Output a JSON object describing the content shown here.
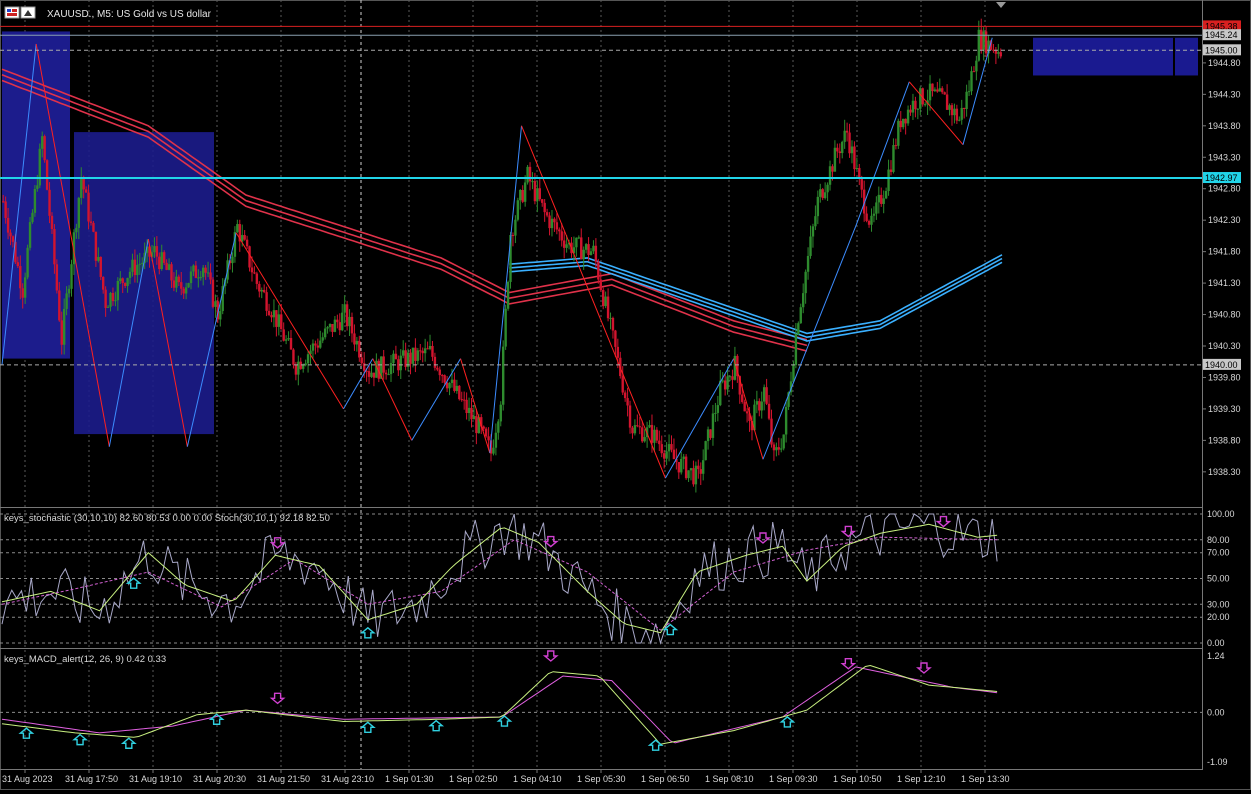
{
  "window": {
    "title": "XAUUSD., M5:  US Gold vs US dollar",
    "menu_icon": "chart-window-menu-icon"
  },
  "price_panel": {
    "price_labels": [
      "1944.80",
      "1944.30",
      "1943.80",
      "1943.30",
      "1942.80",
      "1942.30",
      "1941.80",
      "1941.30",
      "1940.80",
      "1940.30",
      "1939.80",
      "1939.30",
      "1938.80",
      "1938.30"
    ],
    "ask_label": "1945.38",
    "bid_label": "1945.24",
    "level_label_1945": "1945.00",
    "level_label_1940": "1940.00",
    "hline_label": "1942.97",
    "colors": {
      "bull": "#2e8b2e",
      "bear": "#d2142e",
      "zigzag_up": "#3c8cff",
      "zigzag_down": "#ff2020",
      "ma_red": "#e0324a",
      "ma_blue": "#3ab0ff",
      "hline": "#21d4e8",
      "box": "#1c1c8c"
    }
  },
  "stoch_panel": {
    "label": "keys_stochastic (30,10,10) 82.60 80.53 0.00 0.00 Stoch(30,10,1) 92.18 82.50",
    "scale": [
      "100.00",
      "80.00",
      "70.00",
      "50.00",
      "30.00",
      "20.00",
      "0.00"
    ]
  },
  "macd_panel": {
    "label": "keys_MACD_alert(12, 26, 9) 0.42 0.33",
    "scale": [
      "1.24",
      "0.00",
      "-1.09"
    ]
  },
  "time_axis": [
    "31 Aug 2023",
    "31 Aug 17:50",
    "31 Aug 19:10",
    "31 Aug 20:30",
    "31 Aug 21:50",
    "31 Aug 23:10",
    "1 Sep 01:30",
    "1 Sep 02:50",
    "1 Sep 04:10",
    "1 Sep 05:30",
    "1 Sep 06:50",
    "1 Sep 08:10",
    "1 Sep 09:30",
    "1 Sep 10:50",
    "1 Sep 12:10",
    "1 Sep 13:30"
  ],
  "chart_data": {
    "type": "candlestick",
    "title": "XAUUSD., M5:  US Gold vs US dollar",
    "y_range": [
      1937.9,
      1945.45
    ],
    "anchors": [
      [
        0,
        1942.6
      ],
      [
        8,
        1941.2
      ],
      [
        16,
        1943.6
      ],
      [
        24,
        1940.4
      ],
      [
        32,
        1943.0
      ],
      [
        42,
        1941.0
      ],
      [
        52,
        1941.5
      ],
      [
        62,
        1941.8
      ],
      [
        72,
        1941.2
      ],
      [
        82,
        1941.6
      ],
      [
        88,
        1940.8
      ],
      [
        96,
        1942.2
      ],
      [
        104,
        1941.3
      ],
      [
        110,
        1940.9
      ],
      [
        120,
        1940.0
      ],
      [
        140,
        1940.8
      ],
      [
        150,
        1939.9
      ],
      [
        175,
        1940.2
      ],
      [
        188,
        1939.4
      ],
      [
        195,
        1939.0
      ],
      [
        200,
        1938.6
      ],
      [
        204,
        1939.5
      ],
      [
        208,
        1942.1
      ],
      [
        215,
        1943.0
      ],
      [
        222,
        1942.4
      ],
      [
        232,
        1941.9
      ],
      [
        242,
        1941.8
      ],
      [
        250,
        1940.4
      ],
      [
        258,
        1939.0
      ],
      [
        266,
        1938.9
      ],
      [
        275,
        1938.5
      ],
      [
        285,
        1938.2
      ],
      [
        294,
        1939.6
      ],
      [
        300,
        1940.0
      ],
      [
        306,
        1939.0
      ],
      [
        312,
        1939.6
      ],
      [
        316,
        1938.5
      ],
      [
        320,
        1938.9
      ],
      [
        326,
        1940.8
      ],
      [
        334,
        1942.6
      ],
      [
        342,
        1943.4
      ],
      [
        346,
        1943.7
      ],
      [
        352,
        1942.7
      ],
      [
        356,
        1942.2
      ],
      [
        362,
        1942.9
      ],
      [
        368,
        1943.9
      ],
      [
        374,
        1944.2
      ],
      [
        380,
        1944.3
      ],
      [
        386,
        1944.2
      ],
      [
        392,
        1943.9
      ],
      [
        396,
        1944.4
      ],
      [
        400,
        1945.2
      ],
      [
        404,
        1945.1
      ],
      [
        408,
        1945.0
      ]
    ],
    "ma": {
      "ma_red_1": [
        [
          0,
          1944.7
        ],
        [
          60,
          1943.8
        ],
        [
          100,
          1942.7
        ],
        [
          180,
          1941.7
        ],
        [
          208,
          1941.15
        ],
        [
          250,
          1941.45
        ],
        [
          300,
          1940.7
        ],
        [
          330,
          1940.4
        ]
      ],
      "ma_blue_1": [
        [
          208,
          1941.6
        ],
        [
          240,
          1941.7
        ],
        [
          330,
          1940.5
        ],
        [
          360,
          1940.7
        ],
        [
          410,
          1941.75
        ]
      ]
    },
    "zigzag": [
      [
        0,
        1940.0
      ],
      [
        14,
        1945.1
      ],
      [
        44,
        1938.7
      ],
      [
        60,
        1942.0
      ],
      [
        76,
        1938.7
      ],
      [
        96,
        1942.1
      ],
      [
        140,
        1939.3
      ],
      [
        152,
        1940.1
      ],
      [
        168,
        1938.8
      ],
      [
        188,
        1940.1
      ],
      [
        200,
        1938.6
      ],
      [
        213,
        1943.8
      ],
      [
        272,
        1938.2
      ],
      [
        300,
        1940.1
      ],
      [
        312,
        1938.5
      ],
      [
        350,
        1942.2
      ],
      [
        372,
        1944.5
      ],
      [
        394,
        1943.5
      ],
      [
        406,
        1945.2
      ]
    ],
    "stochastic": {
      "main": [
        [
          0,
          32
        ],
        [
          20,
          40
        ],
        [
          40,
          25
        ],
        [
          60,
          70
        ],
        [
          75,
          45
        ],
        [
          95,
          32
        ],
        [
          112,
          68
        ],
        [
          130,
          60
        ],
        [
          150,
          18
        ],
        [
          170,
          30
        ],
        [
          185,
          60
        ],
        [
          205,
          90
        ],
        [
          220,
          78
        ],
        [
          240,
          40
        ],
        [
          255,
          15
        ],
        [
          270,
          8
        ],
        [
          285,
          55
        ],
        [
          305,
          68
        ],
        [
          320,
          75
        ],
        [
          330,
          48
        ],
        [
          345,
          75
        ],
        [
          360,
          85
        ],
        [
          380,
          92
        ],
        [
          400,
          82
        ],
        [
          410,
          84
        ]
      ],
      "signal": [
        [
          0,
          30
        ],
        [
          30,
          42
        ],
        [
          60,
          55
        ],
        [
          90,
          28
        ],
        [
          120,
          65
        ],
        [
          150,
          30
        ],
        [
          180,
          40
        ],
        [
          210,
          80
        ],
        [
          240,
          55
        ],
        [
          270,
          10
        ],
        [
          300,
          55
        ],
        [
          330,
          72
        ],
        [
          360,
          82
        ],
        [
          410,
          80
        ]
      ],
      "levels": [
        100,
        80,
        70,
        50,
        30,
        20,
        0
      ]
    },
    "macd": {
      "main": [
        [
          0,
          -0.25
        ],
        [
          30,
          -0.45
        ],
        [
          55,
          -0.55
        ],
        [
          80,
          -0.05
        ],
        [
          100,
          0.05
        ],
        [
          140,
          -0.2
        ],
        [
          180,
          -0.15
        ],
        [
          205,
          -0.1
        ],
        [
          225,
          0.9
        ],
        [
          245,
          0.8
        ],
        [
          270,
          -0.7
        ],
        [
          300,
          -0.4
        ],
        [
          330,
          0.05
        ],
        [
          355,
          1.05
        ],
        [
          380,
          0.6
        ],
        [
          400,
          0.5
        ],
        [
          410,
          0.45
        ]
      ],
      "signal": [
        [
          0,
          -0.15
        ],
        [
          40,
          -0.45
        ],
        [
          70,
          -0.3
        ],
        [
          100,
          0.05
        ],
        [
          140,
          -0.15
        ],
        [
          205,
          -0.1
        ],
        [
          230,
          0.8
        ],
        [
          250,
          0.7
        ],
        [
          275,
          -0.68
        ],
        [
          320,
          -0.1
        ],
        [
          350,
          1.0
        ],
        [
          390,
          0.55
        ],
        [
          410,
          0.42
        ]
      ],
      "range": [
        -1.09,
        1.24
      ]
    },
    "signal_arrows": {
      "stoch_down": [
        113,
        225,
        312,
        347,
        386
      ],
      "stoch_up": [
        54,
        150,
        274
      ],
      "macd_down": [
        113,
        225,
        347,
        378
      ],
      "macd_up": [
        10,
        32,
        52,
        88,
        150,
        178,
        206,
        268,
        322
      ]
    },
    "count": 410
  }
}
